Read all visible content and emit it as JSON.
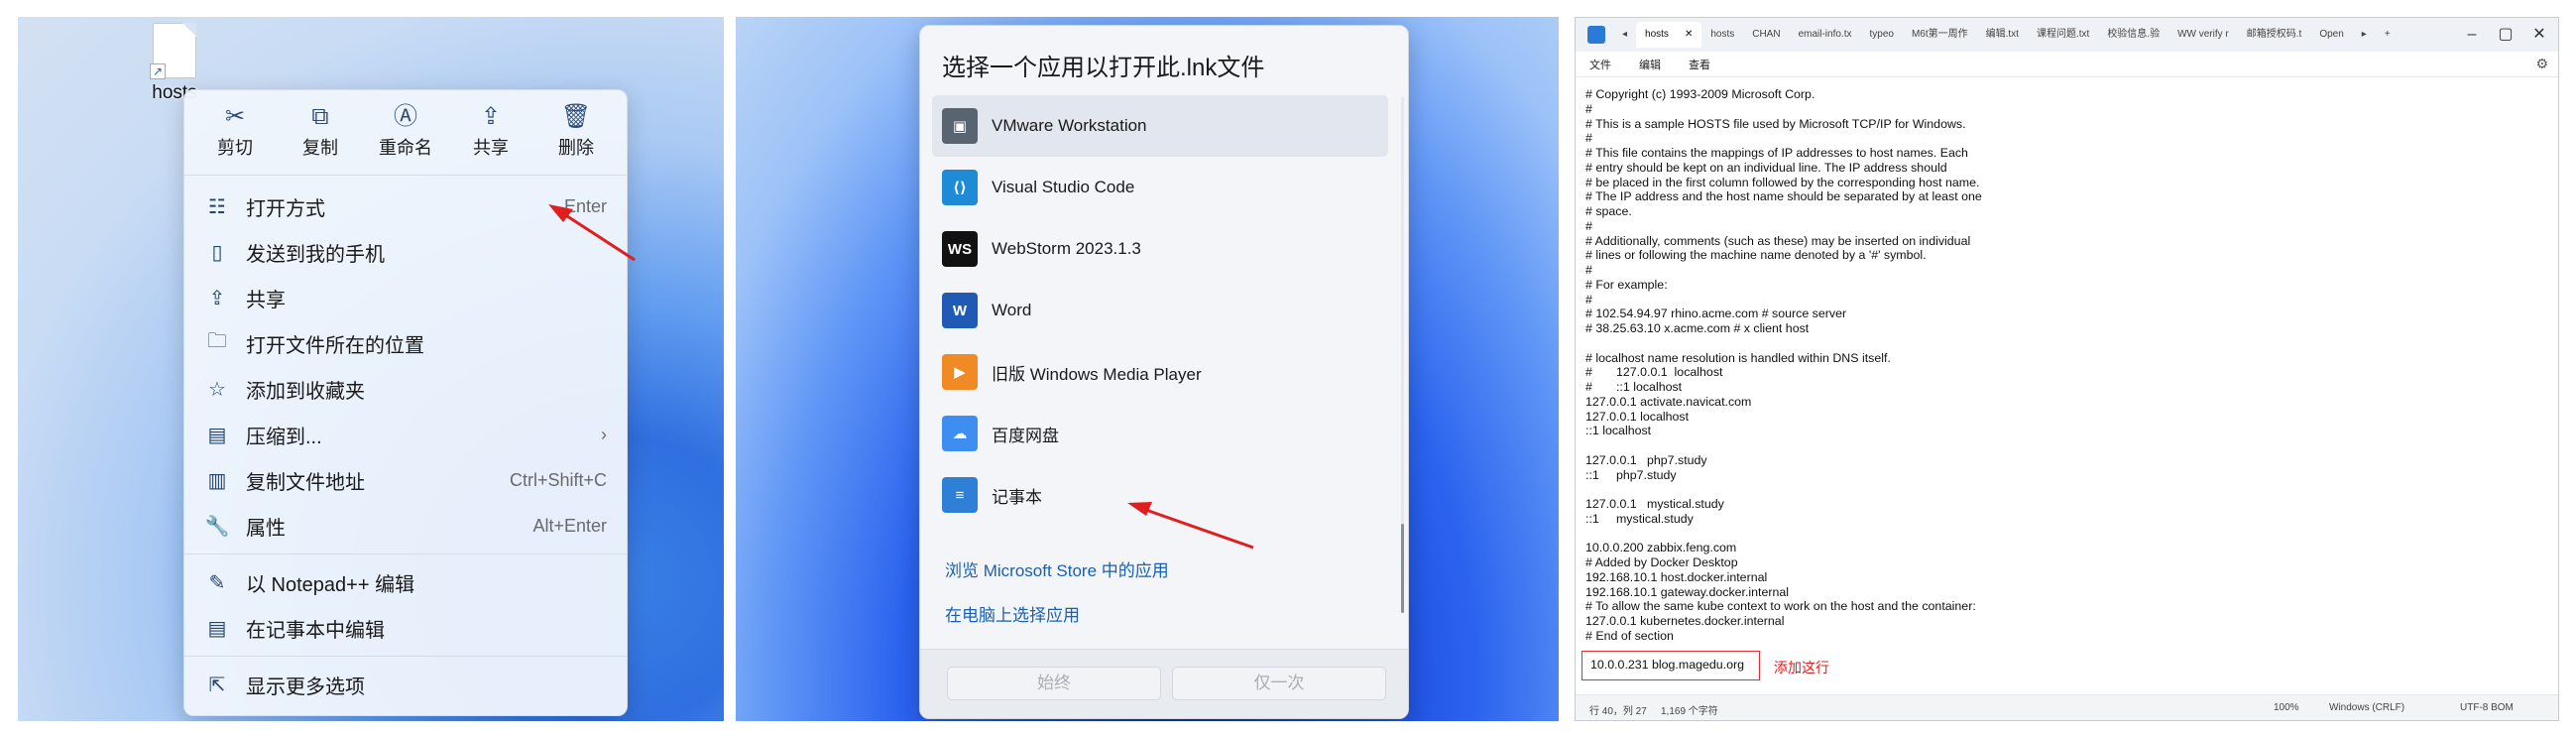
{
  "panel1": {
    "desktop_file": {
      "name": "hosts"
    },
    "actions": [
      {
        "label": "剪切",
        "icon": "scissors-icon",
        "glyph": "✂"
      },
      {
        "label": "复制",
        "icon": "copy-icon",
        "glyph": "⧉"
      },
      {
        "label": "重命名",
        "icon": "rename-icon",
        "glyph": "Ⓐ"
      },
      {
        "label": "共享",
        "icon": "share-icon",
        "glyph": "⇪"
      },
      {
        "label": "删除",
        "icon": "trash-icon",
        "glyph": "🗑"
      }
    ],
    "items": [
      {
        "label": "打开方式",
        "shortcut": "Enter",
        "icon": "open-with-icon",
        "glyph": "☷"
      },
      {
        "label": "发送到我的手机",
        "shortcut": "",
        "icon": "phone-icon",
        "glyph": "▯"
      },
      {
        "label": "共享",
        "shortcut": "",
        "icon": "share-icon",
        "glyph": "⇪"
      },
      {
        "label": "打开文件所在的位置",
        "shortcut": "",
        "icon": "folder-icon",
        "glyph": "🗀"
      },
      {
        "label": "添加到收藏夹",
        "shortcut": "",
        "icon": "star-icon",
        "glyph": "☆"
      },
      {
        "label": "压缩到...",
        "shortcut": "",
        "icon": "archive-icon",
        "glyph": "▤"
      },
      {
        "label": "复制文件地址",
        "shortcut": "Ctrl+Shift+C",
        "icon": "copy-path-icon",
        "glyph": "▥"
      },
      {
        "label": "属性",
        "shortcut": "Alt+Enter",
        "icon": "wrench-icon",
        "glyph": "🔧"
      },
      {
        "label": "以 Notepad++ 编辑",
        "shortcut": "",
        "icon": "notepadpp-icon",
        "glyph": "✎"
      },
      {
        "label": "在记事本中编辑",
        "shortcut": "",
        "icon": "notepad-icon",
        "glyph": "▤"
      },
      {
        "label": "显示更多选项",
        "shortcut": "",
        "icon": "more-options-icon",
        "glyph": "⇱"
      }
    ]
  },
  "panel2": {
    "title": "选择一个应用以打开此.lnk文件",
    "apps": [
      {
        "name": "VMware Workstation",
        "icon": "vmware-icon",
        "glyph": "▣",
        "color": "#5a6470",
        "selected": true
      },
      {
        "name": "Visual Studio Code",
        "icon": "vscode-icon",
        "glyph": "⟨⟩",
        "color": "#1f8ad6",
        "selected": false
      },
      {
        "name": "WebStorm 2023.1.3",
        "icon": "webstorm-icon",
        "glyph": "WS",
        "color": "#111111",
        "selected": false
      },
      {
        "name": "Word",
        "icon": "word-icon",
        "glyph": "W",
        "color": "#1f5bb5",
        "selected": false
      },
      {
        "name": "旧版 Windows Media Player",
        "icon": "media-player-icon",
        "glyph": "▶",
        "color": "#f08a24",
        "selected": false
      },
      {
        "name": "百度网盘",
        "icon": "baidu-netdisk-icon",
        "glyph": "☁",
        "color": "#3d8ef0",
        "selected": false
      },
      {
        "name": "记事本",
        "icon": "notepad-icon",
        "glyph": "≡",
        "color": "#2f7fd6",
        "selected": false
      }
    ],
    "store_link": "浏览 Microsoft Store 中的应用",
    "pc_link": "在电脑上选择应用",
    "always_label": "始终",
    "once_label": "仅一次"
  },
  "panel3": {
    "tabs": [
      {
        "label": "hosts",
        "active": true
      },
      {
        "label": "hosts",
        "active": false
      },
      {
        "label": "CHAN",
        "active": false
      },
      {
        "label": "email-info.tx",
        "active": false
      },
      {
        "label": "typeo",
        "active": false
      },
      {
        "label": "M6t第一周作",
        "active": false
      },
      {
        "label": "编辑.txt",
        "active": false
      },
      {
        "label": "课程问题.txt",
        "active": false
      },
      {
        "label": "校验信息.验",
        "active": false
      },
      {
        "label": "WW verify r",
        "active": false
      },
      {
        "label": "邮箱授权码.t",
        "active": false
      },
      {
        "label": "Open",
        "active": false
      }
    ],
    "menu": [
      "文件",
      "编辑",
      "查看"
    ],
    "lines": [
      "# Copyright (c) 1993-2009 Microsoft Corp.",
      "#",
      "# This is a sample HOSTS file used by Microsoft TCP/IP for Windows.",
      "#",
      "# This file contains the mappings of IP addresses to host names. Each",
      "# entry should be kept on an individual line. The IP address should",
      "# be placed in the first column followed by the corresponding host name.",
      "# The IP address and the host name should be separated by at least one",
      "# space.",
      "#",
      "# Additionally, comments (such as these) may be inserted on individual",
      "# lines or following the machine name denoted by a '#' symbol.",
      "#",
      "# For example:",
      "#",
      "# 102.54.94.97 rhino.acme.com # source server",
      "# 38.25.63.10 x.acme.com # x client host",
      "",
      "# localhost name resolution is handled within DNS itself.",
      "#       127.0.0.1  localhost",
      "#       ::1 localhost",
      "127.0.0.1 activate.navicat.com",
      "127.0.0.1 localhost",
      "::1 localhost",
      "",
      "127.0.0.1   php7.study",
      "::1     php7.study",
      "",
      "127.0.0.1   mystical.study",
      "::1     mystical.study",
      "",
      "10.0.0.200 zabbix.feng.com",
      "# Added by Docker Desktop",
      "192.168.10.1 host.docker.internal",
      "192.168.10.1 gateway.docker.internal",
      "# To allow the same kube context to work on the host and the container:",
      "127.0.0.1 kubernetes.docker.internal",
      "# End of section"
    ],
    "added_line": "10.0.0.231 blog.magedu.org",
    "annotation": "添加这行",
    "status": {
      "position": "行 40，列 27",
      "chars": "1,169 个字符",
      "zoom": "100%",
      "eol": "Windows (CRLF)",
      "encoding": "UTF-8 BOM"
    }
  }
}
